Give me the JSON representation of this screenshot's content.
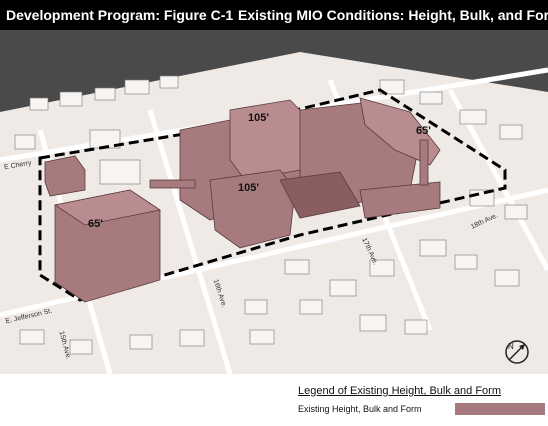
{
  "header": {
    "title_left": "Development Program: Figure C-1",
    "title_right": "Existing MIO Conditions: Height, Bulk, and Form"
  },
  "map": {
    "height_labels": [
      "105'",
      "105'",
      "65'",
      "65'"
    ],
    "street_labels": [
      "E. Jefferson St.",
      "15th Ave.",
      "16th Ave.",
      "17th Ave.",
      "18th Ave.",
      "E Cherry"
    ],
    "colors": {
      "mio_building": "#a77a7d",
      "ground": "#efeae6",
      "street": "#ffffff",
      "surround": "#4a4a4a",
      "boundary": "#000000"
    }
  },
  "compass": {
    "icon": "north-arrow-icon"
  },
  "legend": {
    "title": "Legend of Existing Height, Bulk and Form",
    "item_label": "Existing Height, Bulk and Form",
    "item_color": "#a77a7d"
  }
}
